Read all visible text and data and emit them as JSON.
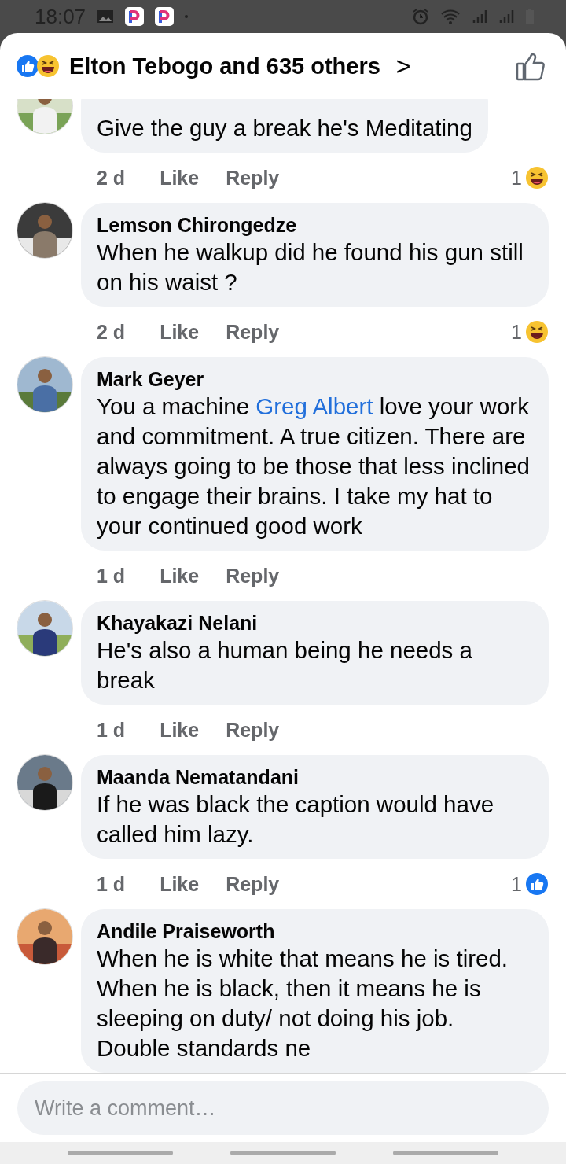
{
  "status_bar": {
    "time": "18:07"
  },
  "header": {
    "reactors": "Elton Tebogo and 635 others",
    "chevron": ">"
  },
  "comments": [
    {
      "parts": [
        {
          "kind": "plain",
          "text": "Give the guy a break he's Meditating"
        }
      ],
      "time": "2 d",
      "like": "Like",
      "reply": "Reply",
      "reaction": {
        "kind": "haha",
        "count": "1"
      }
    },
    {
      "author": "Lemson Chirongedze",
      "parts": [
        {
          "kind": "plain",
          "text": "When he walkup did he found his gun still on his waist ?"
        }
      ],
      "time": "2 d",
      "like": "Like",
      "reply": "Reply",
      "reaction": {
        "kind": "haha",
        "count": "1"
      }
    },
    {
      "author": "Mark Geyer",
      "parts": [
        {
          "kind": "plain",
          "text": "You a machine "
        },
        {
          "kind": "mention",
          "text": "Greg Albert"
        },
        {
          "kind": "plain",
          "text": "  love your work and commitment. A true citizen. There are always going to be those that less inclined to engage their brains. I take my hat to your continued good work"
        }
      ],
      "time": "1 d",
      "like": "Like",
      "reply": "Reply"
    },
    {
      "author": "Khayakazi Nelani",
      "parts": [
        {
          "kind": "plain",
          "text": "He's also a human being he needs a break"
        }
      ],
      "time": "1 d",
      "like": "Like",
      "reply": "Reply"
    },
    {
      "author": "Maanda Nematandani",
      "parts": [
        {
          "kind": "plain",
          "text": "If he was black the caption would have called him lazy."
        }
      ],
      "time": "1 d",
      "like": "Like",
      "reply": "Reply",
      "reaction": {
        "kind": "like",
        "count": "1"
      }
    },
    {
      "author": "Andile Praiseworth",
      "parts": [
        {
          "kind": "plain",
          "text": "When he is white that means he is tired. When he is black, then it means he is sleeping on duty/ not doing his job. Double standards ne"
        }
      ]
    }
  ],
  "composer": {
    "placeholder": "Write a comment…"
  }
}
